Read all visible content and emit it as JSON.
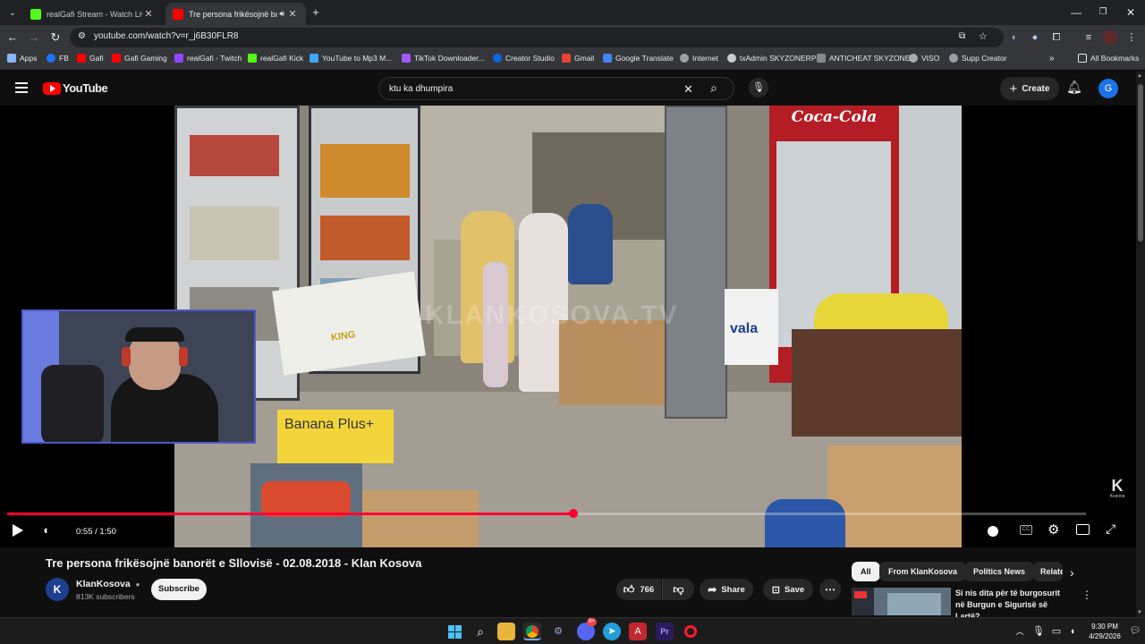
{
  "browser": {
    "tabs": [
      {
        "title": "realGafi Stream - Watch Live on Kick",
        "favicon_color": "#53fc18",
        "active": false
      },
      {
        "title": "Tre persona frikësojnë banorët e Sllovisë",
        "favicon_color": "#ff0000",
        "active": true
      }
    ],
    "url": "youtube.com/watch?v=r_j6B30FLR8",
    "bookmarks": [
      {
        "label": "Apps",
        "icon": "apps-grid-icon",
        "color": "#8ab4f8"
      },
      {
        "label": "FB",
        "icon": "facebook-icon",
        "color": "#1877f2"
      },
      {
        "label": "Gafi",
        "icon": "youtube-icon",
        "color": "#ff0000"
      },
      {
        "label": "Gafi Gaming",
        "icon": "youtube-icon",
        "color": "#ff0000"
      },
      {
        "label": "realGafi - Twitch",
        "icon": "twitch-icon",
        "color": "#9146ff"
      },
      {
        "label": "realGafi Kick",
        "icon": "kick-icon",
        "color": "#53fc18"
      },
      {
        "label": "YouTube to Mp3 M...",
        "icon": "download-icon",
        "color": "#3ea6ff"
      },
      {
        "label": "TikTok Downloader...",
        "icon": "tiktok-icon",
        "color": "#a259ff"
      },
      {
        "label": "Creator Studio",
        "icon": "meta-icon",
        "color": "#0668e1"
      },
      {
        "label": "Gmail",
        "icon": "gmail-icon",
        "color": "#ea4335"
      },
      {
        "label": "Google Translate",
        "icon": "translate-icon",
        "color": "#4285f4"
      },
      {
        "label": "Internet",
        "icon": "globe-icon",
        "color": "#9aa0a6"
      },
      {
        "label": "txAdmin SKYZONERP",
        "icon": "txadmin-icon",
        "color": "#cccccc"
      },
      {
        "label": "ANTICHEAT SKYZONE",
        "icon": "shield-icon",
        "color": "#888888"
      },
      {
        "label": "VISO",
        "icon": "viso-icon",
        "color": "#aaaaaa"
      },
      {
        "label": "Supp Creator",
        "icon": "globe-icon",
        "color": "#9aa0a6"
      }
    ],
    "all_bookmarks_label": "All Bookmarks"
  },
  "youtube": {
    "logo_text": "YouTube",
    "search_query": "ktu ka dhumpira",
    "create_label": "Create",
    "avatar_letter": "G"
  },
  "video": {
    "watermark": "KLANKOSOVA.TV",
    "current_time": "0:55",
    "duration": "1:50",
    "time_display": "0:55 / 1:50",
    "progress": 0.525,
    "overlay_texts": {
      "coca_cola": "Coca-Cola",
      "banana_box": "Banana Plus+",
      "king": "KING",
      "vala": "vala",
      "channel_mark": "Kosova"
    },
    "colors": {
      "progress": "#ff0033"
    }
  },
  "details": {
    "title": "Tre persona frikësojnë banorët e Sllovisë - 02.08.2018 - Klan Kosova",
    "channel_name": "KlanKosova",
    "channel_initial": "K",
    "subscribers": "813K subscribers",
    "subscribe_label": "Subscribe",
    "likes": "766",
    "share_label": "Share",
    "save_label": "Save"
  },
  "sidebar": {
    "chips": [
      "All",
      "From KlanKosova",
      "Politics News",
      "Related"
    ],
    "recommended": [
      {
        "title": "Si nis dita për të burgosurit në Burgun e Sigurisë së Lartë?"
      }
    ]
  },
  "taskbar": {
    "time": "9:30 PM",
    "date": "4/29/2026",
    "discord_badge": "9+"
  }
}
